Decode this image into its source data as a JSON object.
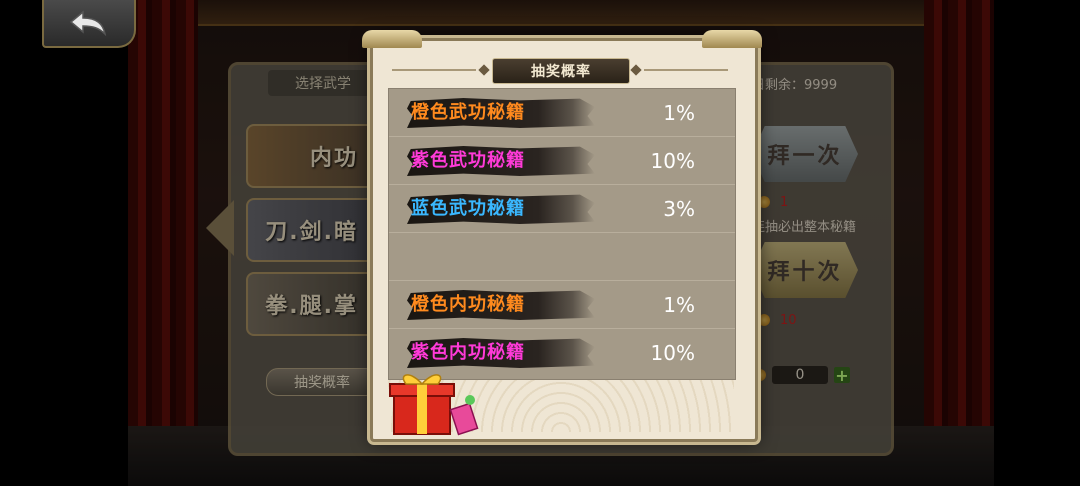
{
  "back_button": {
    "icon": "back-arrow-icon"
  },
  "background": {
    "select_label": "选择武学",
    "daily_remaining": "日剩余：9999",
    "categories": [
      "内功",
      "刀.剑.暗",
      "拳.腿.掌"
    ],
    "prob_button_label": "抽奖概率",
    "draw_once_label": "拜一次",
    "draw_once_cost": "1",
    "hint": "连抽必出整本秘籍",
    "draw_ten_label": "拜十次",
    "draw_ten_cost": "10",
    "stock_value": "0",
    "plus_label": "+"
  },
  "modal": {
    "title": "抽奖概率",
    "rows": [
      {
        "name": "橙色武功秘籍",
        "pct": "1%",
        "color": "#ff8a1e"
      },
      {
        "name": "紫色武功秘籍",
        "pct": "10%",
        "color": "#ff3ad8"
      },
      {
        "name": "蓝色武功秘籍",
        "pct": "3%",
        "color": "#3ab8ff"
      },
      {
        "name": "",
        "pct": "",
        "color": ""
      },
      {
        "name": "橙色内功秘籍",
        "pct": "1%",
        "color": "#ff8a1e"
      },
      {
        "name": "紫色内功秘籍",
        "pct": "10%",
        "color": "#ff3ad8"
      }
    ]
  }
}
